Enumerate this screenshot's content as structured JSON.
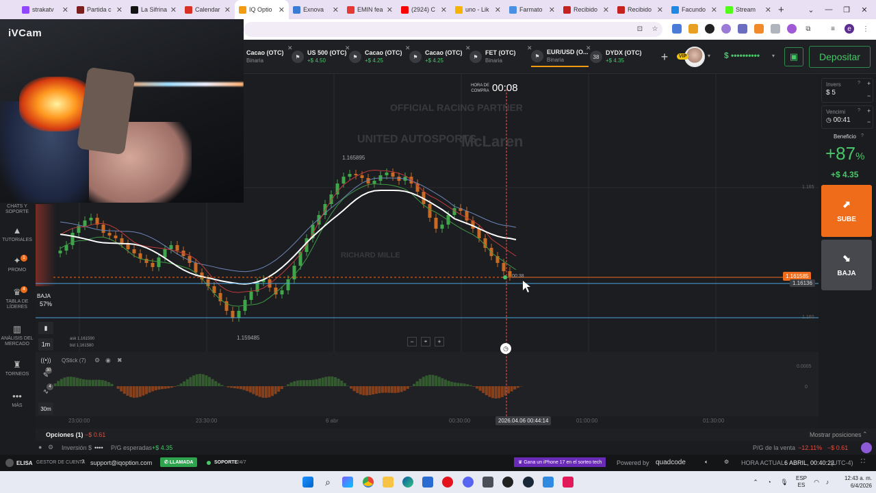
{
  "browser": {
    "tabs": [
      {
        "label": "strakatv",
        "color": "#9146ff"
      },
      {
        "label": "Partida c",
        "color": "#7a1f1f"
      },
      {
        "label": "La Sifrina",
        "color": "#111111"
      },
      {
        "label": "Calendar",
        "color": "#d93025"
      },
      {
        "label": "IQ Optio",
        "color": "#f39c12",
        "active": true
      },
      {
        "label": "Exnova",
        "color": "#3a7bd5"
      },
      {
        "label": "EMIN fea",
        "color": "#e53935"
      },
      {
        "label": "(2924) C",
        "color": "#ff0000"
      },
      {
        "label": "uno - Lik",
        "color": "#f6b400"
      },
      {
        "label": "Farmato",
        "color": "#4a90e2"
      },
      {
        "label": "Recibido",
        "color": "#c5221f"
      },
      {
        "label": "Recibido",
        "color": "#c5221f"
      },
      {
        "label": "Facundo",
        "color": "#1e88e5"
      },
      {
        "label": "Stream",
        "color": "#53fc18"
      }
    ],
    "new_tab": "+",
    "window_controls": [
      "⌄",
      "—",
      "❐",
      "✕"
    ]
  },
  "camera": {
    "label": "iVCam"
  },
  "header": {
    "assets": [
      {
        "name": "Cacao (OTC)",
        "sub": "Binaria",
        "profit": ""
      },
      {
        "name": "US 500 (OTC)",
        "sub": "",
        "profit": "+$ 4.50"
      },
      {
        "name": "Cacao (OTC)",
        "sub": "",
        "profit": "+$ 4.25"
      },
      {
        "name": "Cacao (OTC)",
        "sub": "",
        "profit": "+$ 4.25"
      },
      {
        "name": "FET (OTC)",
        "sub": "Binaria",
        "profit": ""
      },
      {
        "name": "EUR/USD (O...",
        "sub": "Binaria",
        "profit": "",
        "active": true
      },
      {
        "name": "DYDX (OTC)",
        "sub": "",
        "profit": "+$ 4.35",
        "badge": "38"
      }
    ],
    "add": "+",
    "vip": "VIP",
    "balance": "$ ••••••••••",
    "deposit": "Depositar"
  },
  "sidebar": {
    "items": [
      {
        "label": "CHATS Y SOPORTE"
      },
      {
        "label": "TUTORIALES"
      },
      {
        "label": "PROMO",
        "badge": "1"
      },
      {
        "label": "TABLA DE LÍDERES",
        "badge": "4"
      },
      {
        "label": "ANÁLISIS DEL MERCADO"
      },
      {
        "label": "TORNEOS"
      },
      {
        "label": "MÁS"
      }
    ]
  },
  "chart": {
    "purchase_label_1": "HORA DE",
    "purchase_label_2": "COMPRA",
    "timer": "00:08",
    "high_label": "1.165895",
    "low_label": "1.159485",
    "price_tag": "1.161585",
    "price_tag2": "1.16136",
    "right_tick_1": "1.165",
    "right_tick_2": "1.160",
    "indicator_tick_1": "0.0005",
    "indicator_tick_2": "0",
    "marker_time": "00:38",
    "sentiment_label": "BAJA",
    "sentiment_pct": "57%",
    "timeframe": "1m",
    "indicator_timeframe": "30m",
    "ask": "ask 1.161590",
    "bid": "bid 1.161580",
    "indicator_name": "QStick (7)",
    "x_ticks": [
      "23:00:00",
      "23:30:00",
      "6 abr",
      "00:30:00",
      "01:00:00",
      "01:30:00"
    ],
    "current_time": "2026.04.06 00:44:14",
    "watermark_1": "OFFICIAL RACING PARTNER",
    "watermark_2": "UNITED AUTOSPORTS",
    "watermark_3": "McLaren",
    "watermark_4": "RICHARD MILLE"
  },
  "right_panel": {
    "investment_label": "Invers",
    "investment_value": "$  5",
    "expiry_label": "Vencimi",
    "expiry_value": "00:41",
    "profit_label": "Beneficio",
    "profit_pct": "+87",
    "profit_pct_sign": "%",
    "profit_amount": "+$ 4.35",
    "up_label": "SUBE",
    "down_label": "BAJA"
  },
  "options_bar": {
    "label": "Opciones (1)",
    "value": "−$ 0.61",
    "show_positions": "Mostrar posiciones"
  },
  "info_bar": {
    "investment": "Inversión $",
    "investment_mask": "••••",
    "expected": "P/G esperadas",
    "expected_value": "+$ 4.35",
    "sale_label": "P/G de la venta",
    "sale_pct": "−12.11%",
    "sale_value": "−$ 0.61"
  },
  "footer": {
    "brand": "ELISA",
    "account_manager": "GESTOR DE CUENTA",
    "email": "support@iqoption.com",
    "call": "LLAMADA",
    "support": "SOPORTE",
    "support_hours": "24/7",
    "promo": "Gana un iPhone 17 en el sorteo tech",
    "powered": "Powered by",
    "powered_brand": "quadcode",
    "time_label": "HORA ACTUAL:",
    "time_value": "6 ABRIL, 00:40:22",
    "tz": "(UTC-4)"
  },
  "taskbar": {
    "lang": "ESP",
    "lang2": "ES",
    "clock": "12:43 a. m.",
    "date": "6/4/2026"
  },
  "colors": {
    "accent": "#f39c12",
    "up": "#ef6c1a",
    "green": "#47c76a",
    "red": "#e74c3c",
    "deposit_border": "#2e8b4e"
  }
}
